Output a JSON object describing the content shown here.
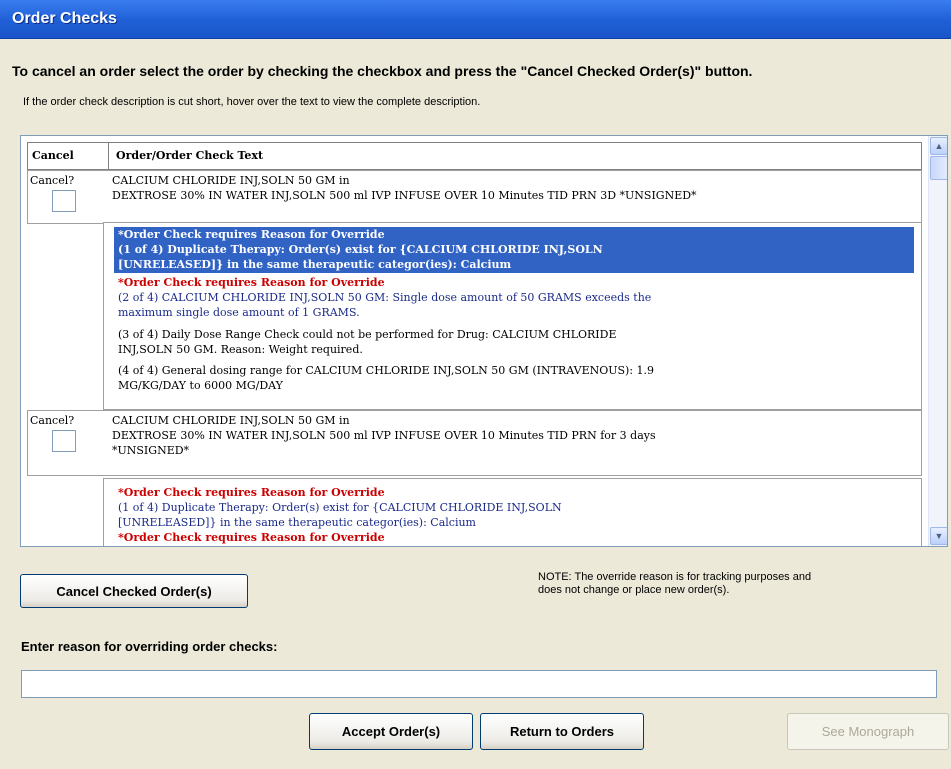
{
  "window": {
    "title": "Order Checks"
  },
  "instructions": "To cancel an order select the order by checking the checkbox and press the \"Cancel Checked Order(s)\" button.",
  "hint": "If the order check description is cut short, hover over the text to view the complete description.",
  "grid": {
    "headers": {
      "cancel": "Cancel",
      "text": "Order/Order Check Text"
    },
    "orders": [
      {
        "cancel_label": "Cancel?",
        "text_lines": [
          "CALCIUM CHLORIDE INJ,SOLN 50 GM in",
          "DEXTROSE 30% IN WATER INJ,SOLN 500 ml IVP INFUSE OVER 10 Minutes TID PRN 3D *UNSIGNED*"
        ],
        "checks": [
          {
            "header": "*Order Check requires Reason for Override",
            "lines": [
              "(1 of 4)  Duplicate Therapy: Order(s) exist for {CALCIUM CHLORIDE INJ,SOLN",
              "[UNRELEASED]} in the same therapeutic categor(ies): Calcium"
            ],
            "selected": true
          },
          {
            "header": "*Order Check requires Reason for Override",
            "lines": [
              "(2 of 4)  CALCIUM CHLORIDE INJ,SOLN 50 GM: Single dose amount of 50 GRAMS exceeds the",
              "maximum single dose amount of 1 GRAMS."
            ],
            "selected": false
          },
          {
            "header": "",
            "lines": [
              "(3 of 4)  Daily Dose Range Check could not be performed for Drug: CALCIUM CHLORIDE",
              "INJ,SOLN 50 GM.  Reason: Weight required."
            ],
            "selected": false
          },
          {
            "header": "",
            "lines": [
              "(4 of 4)  General dosing range for CALCIUM CHLORIDE INJ,SOLN 50 GM (INTRAVENOUS): 1.9",
              "MG/KG/DAY to 6000 MG/DAY"
            ],
            "selected": false
          }
        ]
      },
      {
        "cancel_label": "Cancel?",
        "text_lines": [
          "CALCIUM CHLORIDE INJ,SOLN 50 GM in",
          "DEXTROSE 30% IN WATER INJ,SOLN 500 ml IVP INFUSE OVER 10 Minutes TID PRN for 3 days",
          "*UNSIGNED*"
        ],
        "checks": [
          {
            "header": "*Order Check requires Reason for Override",
            "lines": [
              "(1 of 4)  Duplicate Therapy: Order(s) exist for {CALCIUM CHLORIDE INJ,SOLN",
              "[UNRELEASED]} in the same therapeutic categor(ies): Calcium"
            ],
            "selected": false
          }
        ]
      }
    ]
  },
  "buttons": {
    "cancel_checked": "Cancel Checked Order(s)",
    "accept": "Accept Order(s)",
    "return": "Return to Orders",
    "monograph": "See Monograph"
  },
  "note_lines": [
    "NOTE: The override reason is for tracking purposes and",
    "does not change or place new order(s)."
  ],
  "reason": {
    "label": "Enter reason for overriding order checks:",
    "value": ""
  },
  "colors": {
    "highlight": "#3163c5",
    "override_red": "#cc0000",
    "text_blue": "#1a2a8a",
    "title_blue": "#1f5fd6"
  }
}
